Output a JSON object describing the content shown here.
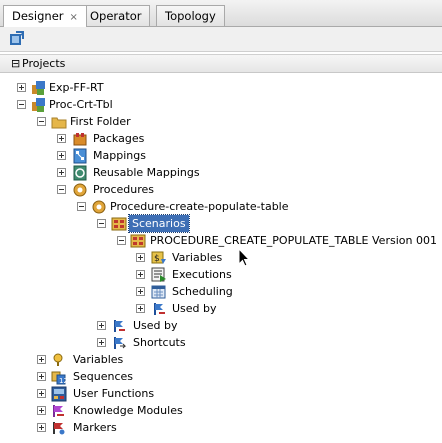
{
  "tabs": [
    {
      "label": "Designer",
      "close": "×"
    },
    {
      "label": "Operator"
    },
    {
      "label": "Topology"
    }
  ],
  "toolbar": {
    "refresh_icon": "refresh-icon"
  },
  "section": {
    "toggle": "⊟",
    "label": "Projects"
  },
  "tree": [
    {
      "label": "Exp-FF-RT",
      "icon": "project-icon"
    },
    {
      "label": "Proc-Crt-Tbl",
      "icon": "project-icon"
    },
    {
      "label": "First Folder",
      "icon": "folder-icon"
    },
    {
      "label": "Packages",
      "icon": "package-icon"
    },
    {
      "label": "Mappings",
      "icon": "mapping-icon"
    },
    {
      "label": "Reusable Mappings",
      "icon": "reusable-mapping-icon"
    },
    {
      "label": "Procedures",
      "icon": "procedure-icon"
    },
    {
      "label": "Procedure-create-populate-table",
      "icon": "procedure-icon"
    },
    {
      "label": "Scenarios",
      "icon": "scenario-icon"
    },
    {
      "label": "PROCEDURE_CREATE_POPULATE_TABLE Version 001",
      "icon": "scenario-icon"
    },
    {
      "label": "Variables",
      "icon": "variable-icon"
    },
    {
      "label": "Executions",
      "icon": "execution-icon"
    },
    {
      "label": "Scheduling",
      "icon": "scheduling-icon"
    },
    {
      "label": "Used by",
      "icon": "used-by-icon"
    },
    {
      "label": "Used by",
      "icon": "used-by-icon"
    },
    {
      "label": "Shortcuts",
      "icon": "shortcut-icon"
    },
    {
      "label": "Variables",
      "icon": "variable-icon"
    },
    {
      "label": "Sequences",
      "icon": "sequence-icon"
    },
    {
      "label": "User Functions",
      "icon": "user-function-icon"
    },
    {
      "label": "Knowledge Modules",
      "icon": "knowledge-module-icon"
    },
    {
      "label": "Markers",
      "icon": "marker-icon"
    }
  ],
  "colors": {
    "selection": "#3e6fb5",
    "tab_border": "#a9a9a9"
  }
}
